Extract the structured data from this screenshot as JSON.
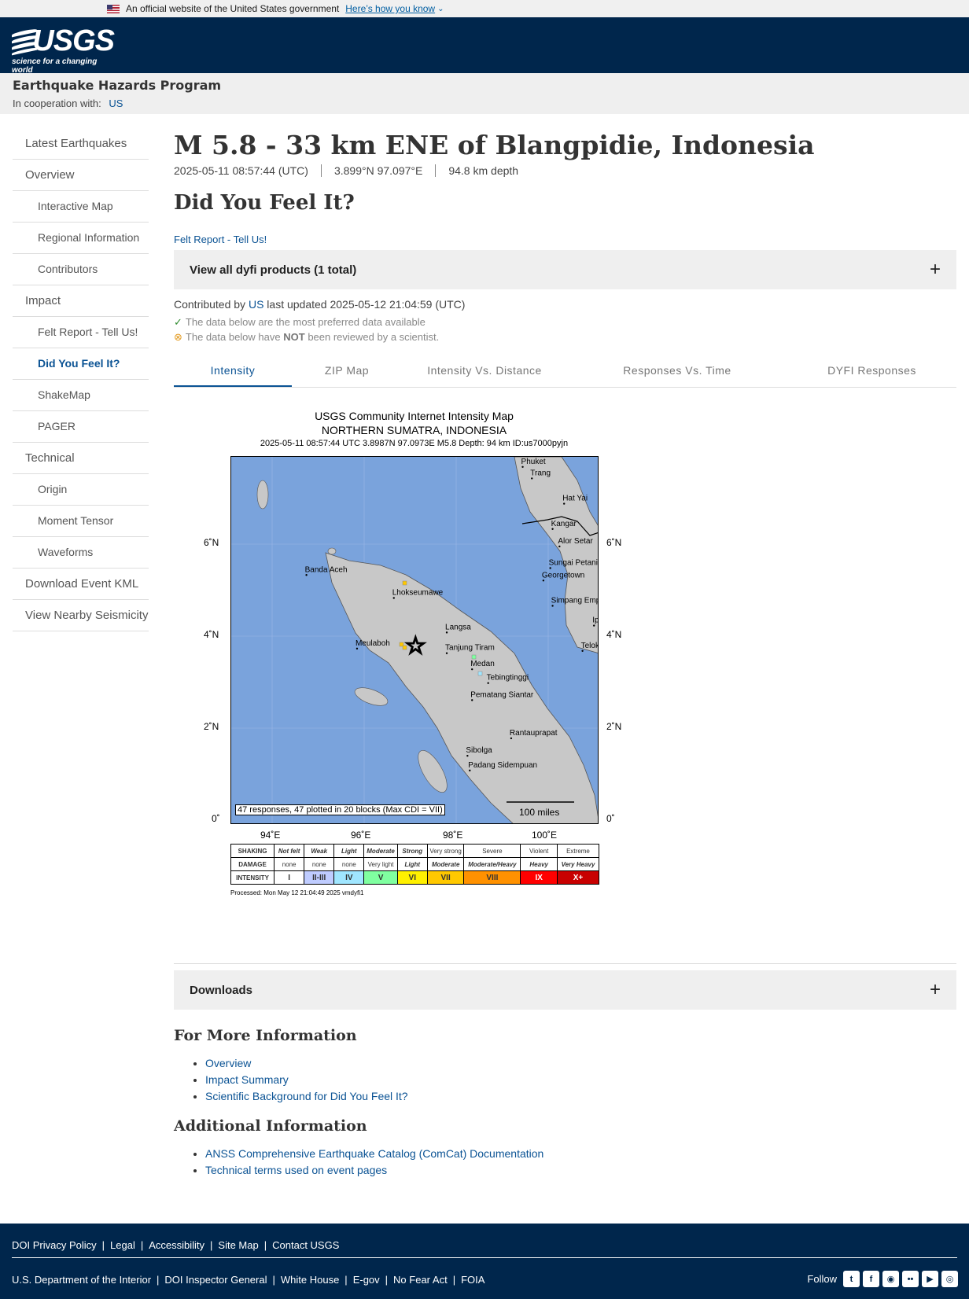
{
  "gov_banner": {
    "text": "An official website of the United States government",
    "link": "Here’s how you know"
  },
  "header": {
    "logo_text": "USGS",
    "logo_tagline": "science for a changing world"
  },
  "site": {
    "program": "Earthquake Hazards Program",
    "coop_label": "In cooperation with:",
    "coop_link": "US"
  },
  "sidebar": {
    "items": [
      {
        "label": "Latest Earthquakes"
      },
      {
        "label": "Overview"
      },
      {
        "label": "Interactive Map"
      },
      {
        "label": "Regional Information"
      },
      {
        "label": "Contributors"
      },
      {
        "label": "Impact"
      },
      {
        "label": "Felt Report - Tell Us!"
      },
      {
        "label": "Did You Feel It?"
      },
      {
        "label": "ShakeMap"
      },
      {
        "label": "PAGER"
      },
      {
        "label": "Technical"
      },
      {
        "label": "Origin"
      },
      {
        "label": "Moment Tensor"
      },
      {
        "label": "Waveforms"
      },
      {
        "label": "Download Event KML"
      },
      {
        "label": "View Nearby Seismicity"
      }
    ]
  },
  "event": {
    "title": "M 5.8 - 33 km ENE of Blangpidie, Indonesia",
    "time": "2025-05-11 08:57:44 (UTC)",
    "location": "3.899°N 97.097°E",
    "depth": "94.8 km depth"
  },
  "dyfi": {
    "title": "Did You Feel It?",
    "felt_link": "Felt Report - Tell Us!",
    "products_label": "View all dyfi products (1 total)",
    "contrib_prefix": "Contributed by",
    "contrib_link": "US",
    "contrib_suffix": "last updated 2025-05-12 21:04:59 (UTC)",
    "note_preferred": "The data below are the most preferred data available",
    "note_review_prefix": "The data below have",
    "note_review_bold": "NOT",
    "note_review_suffix": "been reviewed by a scientist."
  },
  "tabs": [
    "Intensity",
    "ZIP Map",
    "Intensity Vs. Distance",
    "Responses Vs. Time",
    "DYFI Responses"
  ],
  "map": {
    "title1": "USGS Community Internet Intensity Map",
    "title2": "NORTHERN SUMATRA, INDONESIA",
    "title3": "2025-05-11 08:57:44 UTC 3.8987N 97.0973E M5.8 Depth: 94 km ID:us7000pyjn",
    "lat_labels": [
      "6˚N",
      "4˚N",
      "2˚N",
      "0˚"
    ],
    "lon_labels": [
      "94˚E",
      "96˚E",
      "98˚E",
      "100˚E"
    ],
    "places": [
      {
        "name": "Phuket",
        "lon": 99.4,
        "lat": 7.85
      },
      {
        "name": "Trang",
        "lon": 99.6,
        "lat": 7.6
      },
      {
        "name": "Hat Yai",
        "lon": 100.3,
        "lat": 7.05
      },
      {
        "name": "Kangar",
        "lon": 100.05,
        "lat": 6.5
      },
      {
        "name": "Alor Setar",
        "lon": 100.2,
        "lat": 6.12
      },
      {
        "name": "Sungai Petani",
        "lon": 100.0,
        "lat": 5.65
      },
      {
        "name": "Georgetown",
        "lon": 99.85,
        "lat": 5.38
      },
      {
        "name": "Simpang Emp",
        "lon": 100.05,
        "lat": 4.83
      },
      {
        "name": "Ipo",
        "lon": 100.95,
        "lat": 4.4
      },
      {
        "name": "Telok I",
        "lon": 100.7,
        "lat": 3.85
      },
      {
        "name": "Banda Aceh",
        "lon": 94.7,
        "lat": 5.5
      },
      {
        "name": "Lhokseumawe",
        "lon": 96.6,
        "lat": 5.0
      },
      {
        "name": "Langsa",
        "lon": 97.75,
        "lat": 4.25
      },
      {
        "name": "Meulaboh",
        "lon": 95.8,
        "lat": 3.9
      },
      {
        "name": "Tanjung Tiram",
        "lon": 97.75,
        "lat": 3.8
      },
      {
        "name": "Medan",
        "lon": 98.3,
        "lat": 3.45
      },
      {
        "name": "Tebingtinggi",
        "lon": 98.65,
        "lat": 3.15
      },
      {
        "name": "Pematang Siantar",
        "lon": 98.3,
        "lat": 2.78
      },
      {
        "name": "Rantauprapat",
        "lon": 99.15,
        "lat": 1.95
      },
      {
        "name": "Sibolga",
        "lon": 98.2,
        "lat": 1.57
      },
      {
        "name": "Padang Sidempuan",
        "lon": 98.25,
        "lat": 1.25
      }
    ],
    "epicenter": {
      "lon": 97.0973,
      "lat": 3.8987
    },
    "responses_box": "47 responses, 47 plotted in 20 blocks (Max CDI = VII)",
    "scale_label": "100 miles",
    "legend": {
      "shaking_label": "SHAKING",
      "damage_label": "DAMAGE",
      "intensity_label": "INTENSITY",
      "shaking": [
        "Not felt",
        "Weak",
        "Light",
        "Moderate",
        "Strong",
        "Very strong",
        "Severe",
        "Violent",
        "Extreme"
      ],
      "damage": [
        "none",
        "none",
        "none",
        "Very light",
        "Light",
        "Moderate",
        "Moderate/Heavy",
        "Heavy",
        "Very Heavy"
      ],
      "intensity": [
        "I",
        "II-III",
        "IV",
        "V",
        "VI",
        "VII",
        "VIII",
        "IX",
        "X+"
      ],
      "colors": [
        "#ffffff",
        "#bfccff",
        "#a0e6ff",
        "#80ffa0",
        "#fff000",
        "#ffc800",
        "#ff9100",
        "#ff0000",
        "#c80000"
      ]
    },
    "processed": "Processed: Mon May 12 21:04:49 2025 vmdyfi1"
  },
  "downloads_label": "Downloads",
  "more_info": {
    "title": "For More Information",
    "links": [
      "Overview",
      "Impact Summary",
      "Scientific Background for Did You Feel It?"
    ]
  },
  "additional_info": {
    "title": "Additional Information",
    "links": [
      "ANSS Comprehensive Earthquake Catalog (ComCat) Documentation",
      "Technical terms used on event pages"
    ]
  },
  "footer": {
    "row1": [
      "DOI Privacy Policy",
      "Legal",
      "Accessibility",
      "Site Map",
      "Contact USGS"
    ],
    "row2": [
      "U.S. Department of the Interior",
      "DOI Inspector General",
      "White House",
      "E-gov",
      "No Fear Act",
      "FOIA"
    ],
    "follow_label": "Follow",
    "social_icons": [
      "twitter-icon",
      "facebook-icon",
      "github-icon",
      "flickr-icon",
      "youtube-icon",
      "instagram-icon"
    ]
  }
}
